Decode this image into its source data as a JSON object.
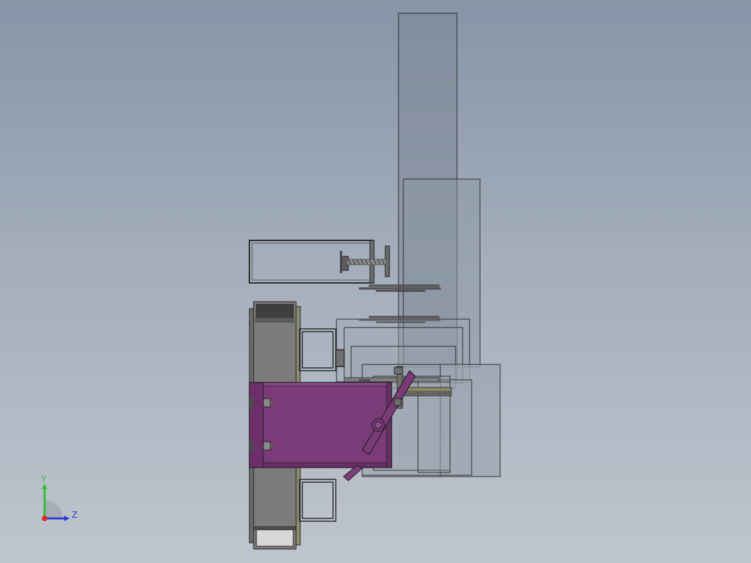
{
  "app": {
    "view": "3d-cad-viewport"
  },
  "triad": {
    "y_label": "Y",
    "z_label": "Z",
    "icons": [
      "y-axis-arrow-icon",
      "z-axis-arrow-icon",
      "x-axis-origin-icon"
    ]
  },
  "colors": {
    "background_top": "#8795a8",
    "background_bottom": "#bfc5ce",
    "accent_part": "#7b3a78",
    "steel": "#808080",
    "transparent_housing": "#9ba4b2",
    "y_axis": "#2ec12e",
    "z_axis": "#2b3fd6",
    "x_axis": "#d62b2b"
  }
}
